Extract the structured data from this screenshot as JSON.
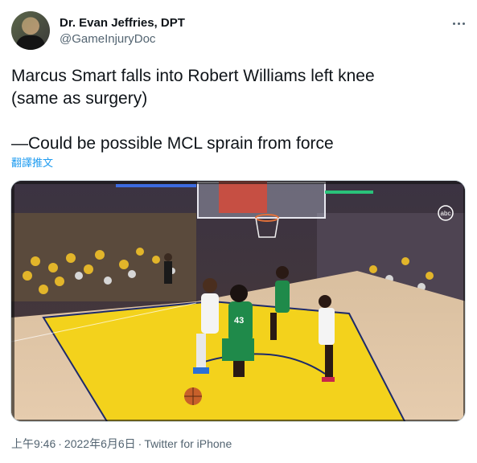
{
  "author": {
    "display_name": "Dr. Evan Jeffries, DPT",
    "handle": "@GameInjuryDoc"
  },
  "tweet": {
    "line1": "Marcus Smart falls into Robert Williams left knee",
    "line2": "(same as surgery)",
    "line3": "—Could be possible MCL sprain from force",
    "translate_label": "翻譯推文"
  },
  "media": {
    "network_logo": "abc",
    "jersey_number": "43"
  },
  "footer": {
    "time": "上午9:46",
    "date": "2022年6月6日",
    "source": "Twitter for iPhone"
  },
  "icons": {
    "more": "more-dots-icon"
  },
  "colors": {
    "link": "#1d9bf0",
    "secondary_text": "#536471",
    "court_paint": "#f3d21c",
    "court_floor": "#e3c8a8",
    "celtics_green": "#1f8a4a"
  }
}
